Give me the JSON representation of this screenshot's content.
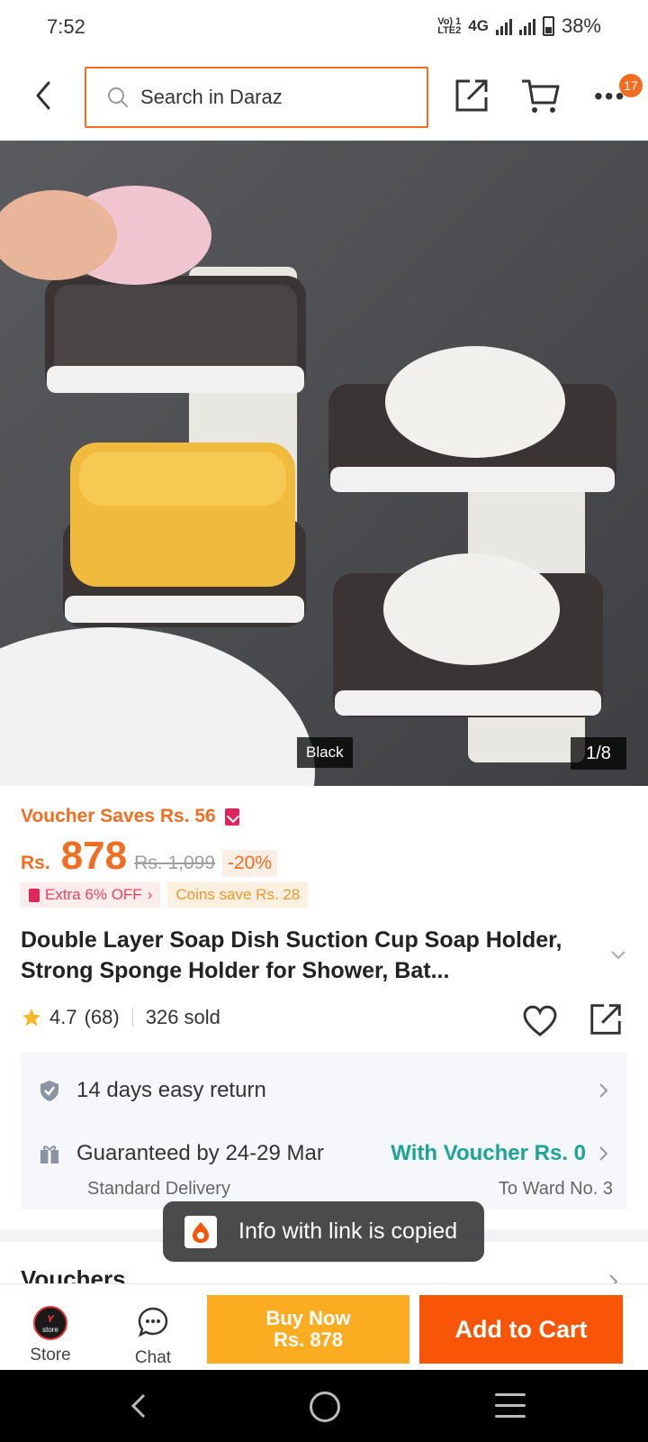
{
  "status_bar": {
    "time": "7:52",
    "volte": "Vo) 1\nLTE2",
    "network": "4G",
    "battery": "38%"
  },
  "header": {
    "search_placeholder": "Search in Daraz",
    "cart_badge": "17"
  },
  "gallery": {
    "variant": "Black",
    "pager": "1/8"
  },
  "price": {
    "voucher_saves": "Voucher Saves Rs. 56",
    "currency": "Rs.",
    "current": "878",
    "original": "Rs. 1,099",
    "discount": "-20%",
    "promo_extra": "Extra 6% OFF",
    "promo_coins": "Coins save Rs. 28"
  },
  "product": {
    "title": "Double Layer Soap Dish Suction Cup Soap Holder, Strong Sponge Holder for Shower, Bat...",
    "rating": "4.7",
    "reviews": "(68)",
    "sold": "326 sold"
  },
  "delivery": {
    "return_policy": "14 days easy return",
    "guarantee": "Guaranteed by 24-29 Mar",
    "voucher": "With Voucher Rs. 0",
    "method": "Standard Delivery",
    "destination": "To Ward No. 3"
  },
  "sections": {
    "vouchers": "Vouchers"
  },
  "toast": {
    "message": "Info with link is copied"
  },
  "bottom_bar": {
    "store_label": "Store",
    "chat_label": "Chat",
    "buy_now_line1": "Buy Now",
    "buy_now_line2": "Rs. 878",
    "add_to_cart": "Add to Cart"
  },
  "colors": {
    "brand": "#f85606",
    "accent": "#f36d21",
    "buy_now": "#fcac20",
    "teal": "#1aa596"
  }
}
